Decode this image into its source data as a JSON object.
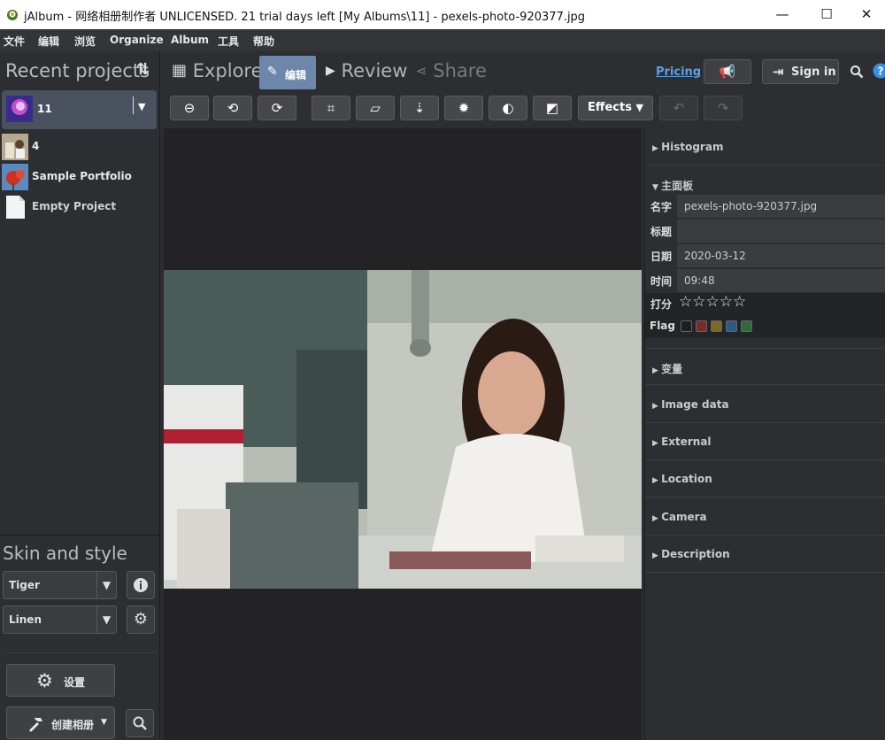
{
  "window": {
    "title": "jAlbum - 网络相册制作者 UNLICENSED. 21 trial days left [My Albums\\11] - pexels-photo-920377.jpg",
    "controls": [
      "—",
      "☐",
      "✕"
    ]
  },
  "menu": [
    "文件",
    "编辑",
    "浏览",
    "Organize",
    "Album",
    "工具",
    "帮助"
  ],
  "left": {
    "recent_title": "Recent projects",
    "sort_icon": "⇅",
    "current_project": "11",
    "projects": [
      "4",
      "Sample Portfolio",
      "Empty Project"
    ],
    "skin_title": "Skin and style",
    "skin": "Tiger",
    "style": "Linen",
    "settings_label": "设置",
    "create_label": "创建相册"
  },
  "tabs": {
    "explore": "Explore",
    "edit": "编辑",
    "review": "Review",
    "share": "Share",
    "pricing": "Pricing",
    "signin": "Sign in"
  },
  "toolbar": {
    "effects": "Effects"
  },
  "panel": {
    "histogram": "Histogram",
    "main": "主面板",
    "fields": [
      {
        "key": "名字",
        "value": "pexels-photo-920377.jpg"
      },
      {
        "key": "标题",
        "value": ""
      },
      {
        "key": "日期",
        "value": "2020-03-12"
      },
      {
        "key": "时间",
        "value": "09:48"
      }
    ],
    "rating_label": "打分",
    "rating_stars": "☆☆☆☆☆",
    "rating_value": 0,
    "flag_label": "Flag",
    "flag_colors": [
      "#1e1e1e",
      "#7a2a2a",
      "#7a6a2a",
      "#2a5a8a",
      "#2e6a3a"
    ],
    "sections": [
      "变量",
      "Image data",
      "External",
      "Location",
      "Camera",
      "Description"
    ]
  },
  "colors": {
    "accent": "#6c87aa",
    "link": "#5aa0e8"
  }
}
